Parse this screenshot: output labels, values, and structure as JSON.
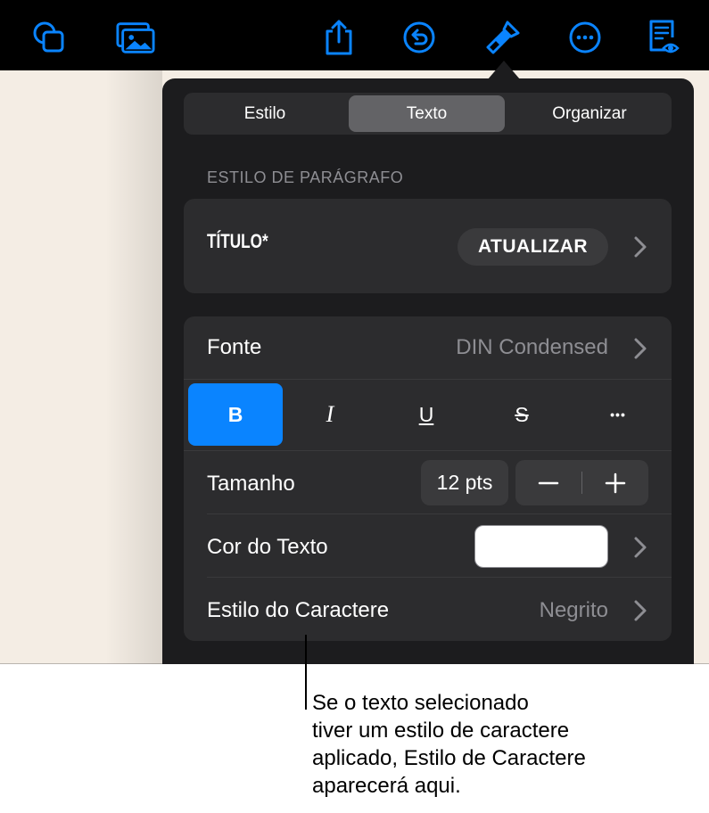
{
  "toolbar": {
    "icons": [
      "shapes-icon",
      "media-icon",
      "share-icon",
      "undo-icon",
      "format-brush-icon",
      "more-icon",
      "reading-view-icon"
    ],
    "accent": "#0a84ff"
  },
  "tabs": [
    {
      "label": "Estilo",
      "active": false
    },
    {
      "label": "Texto",
      "active": true
    },
    {
      "label": "Organizar",
      "active": false
    }
  ],
  "paragraph_style": {
    "section_label": "ESTILO DE PARÁGRAFO",
    "current": "TÍTULO*",
    "update_label": "ATUALIZAR"
  },
  "font": {
    "label": "Fonte",
    "value": "DIN Condensed"
  },
  "format_buttons": [
    {
      "label": "B",
      "name": "bold",
      "active": true
    },
    {
      "label": "I",
      "name": "italic",
      "active": false
    },
    {
      "label": "U",
      "name": "underline",
      "active": false
    },
    {
      "label": "S",
      "name": "strikethrough",
      "active": false
    },
    {
      "label": "•••",
      "name": "more-options",
      "active": false
    }
  ],
  "size": {
    "label": "Tamanho",
    "value": "12 pts"
  },
  "text_color": {
    "label": "Cor do Texto",
    "swatch": "#ffffff"
  },
  "character_style": {
    "label": "Estilo do Caractere",
    "value": "Negrito"
  },
  "callout": {
    "lines": [
      "Se o texto selecionado",
      "tiver um estilo de caractere",
      "aplicado, Estilo de Caractere",
      "aparecerá aqui."
    ]
  }
}
